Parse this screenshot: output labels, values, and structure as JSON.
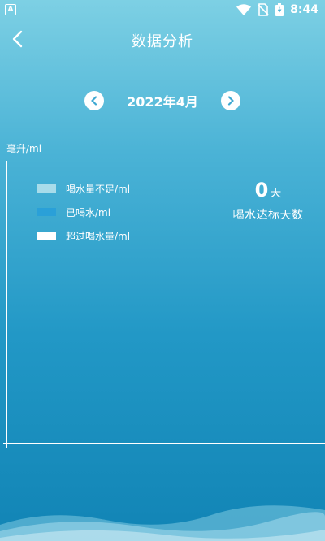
{
  "status_bar": {
    "app_badge": "A",
    "time": "8:44"
  },
  "header": {
    "title": "数据分析"
  },
  "month_nav": {
    "label": "2022年4月"
  },
  "chart": {
    "unit_label": "毫升/ml",
    "legend": [
      {
        "label": "喝水量不足/ml",
        "color": "#a8dcea"
      },
      {
        "label": "已喝水/ml",
        "color": "#2aa0d8"
      },
      {
        "label": "超过喝水量/ml",
        "color": "#ffffff"
      }
    ]
  },
  "stats": {
    "goal_days": "0",
    "goal_days_unit": "天",
    "goal_days_caption": "喝水达标天数"
  },
  "colors": {
    "bg_top": "#7dd0e4",
    "bg_bottom": "#1184b5",
    "nav_arrow": "#3fa9d2"
  }
}
